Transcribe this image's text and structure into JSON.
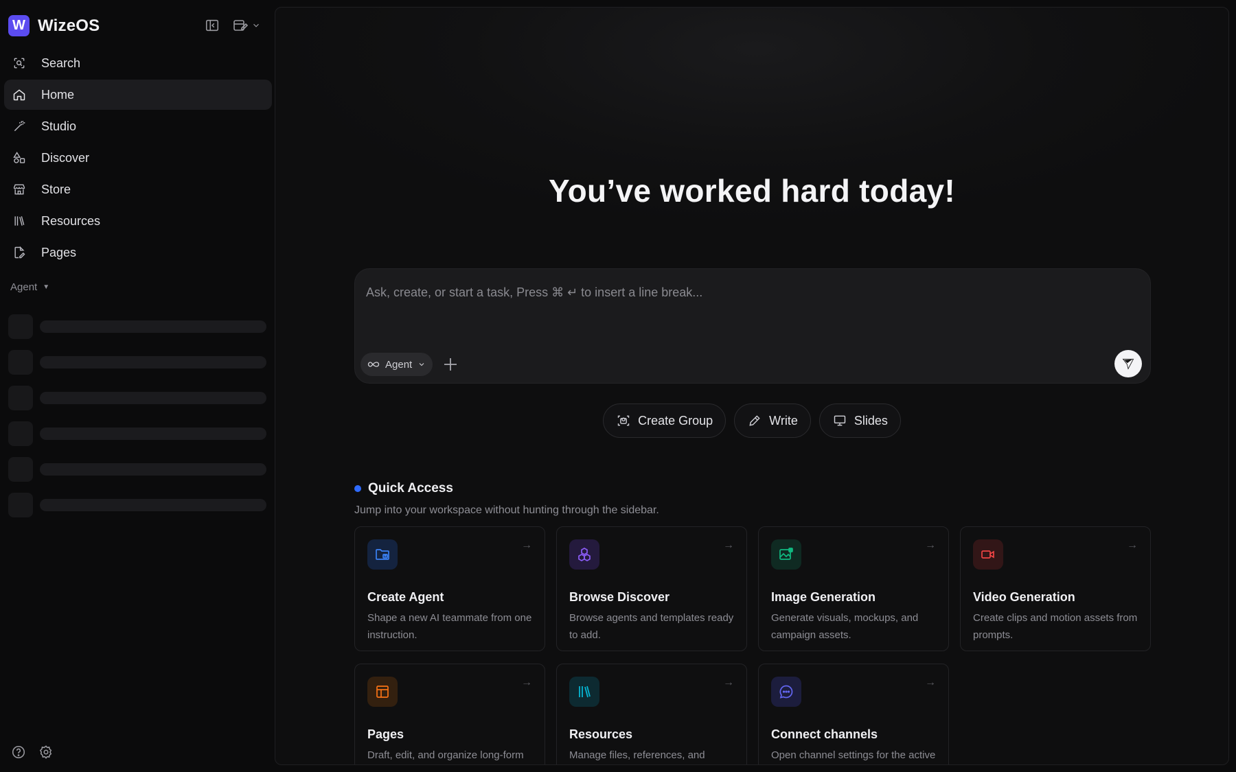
{
  "app": {
    "name": "WizeOS",
    "logo_letter": "W"
  },
  "sidebar": {
    "items": [
      {
        "label": "Search",
        "icon": "search-icon"
      },
      {
        "label": "Home",
        "icon": "home-icon",
        "active": true
      },
      {
        "label": "Studio",
        "icon": "magic-wand-icon"
      },
      {
        "label": "Discover",
        "icon": "shapes-icon"
      },
      {
        "label": "Store",
        "icon": "store-icon"
      },
      {
        "label": "Resources",
        "icon": "library-icon"
      },
      {
        "label": "Pages",
        "icon": "page-edit-icon"
      }
    ],
    "agent_section": {
      "label": "Agent",
      "caret": "▼"
    }
  },
  "main": {
    "headline": "You’ve worked hard today!",
    "composer": {
      "placeholder": "Ask, create, or start a task, Press ⌘ ↵ to insert a line break...",
      "mode_label": "Agent"
    },
    "chips": [
      {
        "label": "Create Group",
        "icon": "group-scan-icon"
      },
      {
        "label": "Write",
        "icon": "pencil-icon"
      },
      {
        "label": "Slides",
        "icon": "presentation-icon"
      }
    ],
    "quick_access": {
      "title": "Quick Access",
      "subtitle": "Jump into your workspace without hunting through the sidebar.",
      "cards": [
        {
          "title": "Create Agent",
          "desc": "Shape a new AI teammate from one instruction.",
          "icon": "folder-user-icon",
          "color": "#3b82f6"
        },
        {
          "title": "Browse Discover",
          "desc": "Browse agents and templates ready to add.",
          "icon": "cubes-icon",
          "color": "#8b5cf6"
        },
        {
          "title": "Image Generation",
          "desc": "Generate visuals, mockups, and campaign assets.",
          "icon": "image-icon",
          "color": "#10b981"
        },
        {
          "title": "Video Generation",
          "desc": "Create clips and motion assets from prompts.",
          "icon": "video-icon",
          "color": "#ef4444"
        },
        {
          "title": "Pages",
          "desc": "Draft, edit, and organize long-form work.",
          "icon": "layout-icon",
          "color": "#f97316"
        },
        {
          "title": "Resources",
          "desc": "Manage files, references, and knowledge.",
          "icon": "library-icon",
          "color": "#06b6d4"
        },
        {
          "title": "Connect channels",
          "desc": "Open channel settings for the active agent.",
          "icon": "chat-bubble-icon",
          "color": "#6366f1"
        }
      ]
    }
  }
}
